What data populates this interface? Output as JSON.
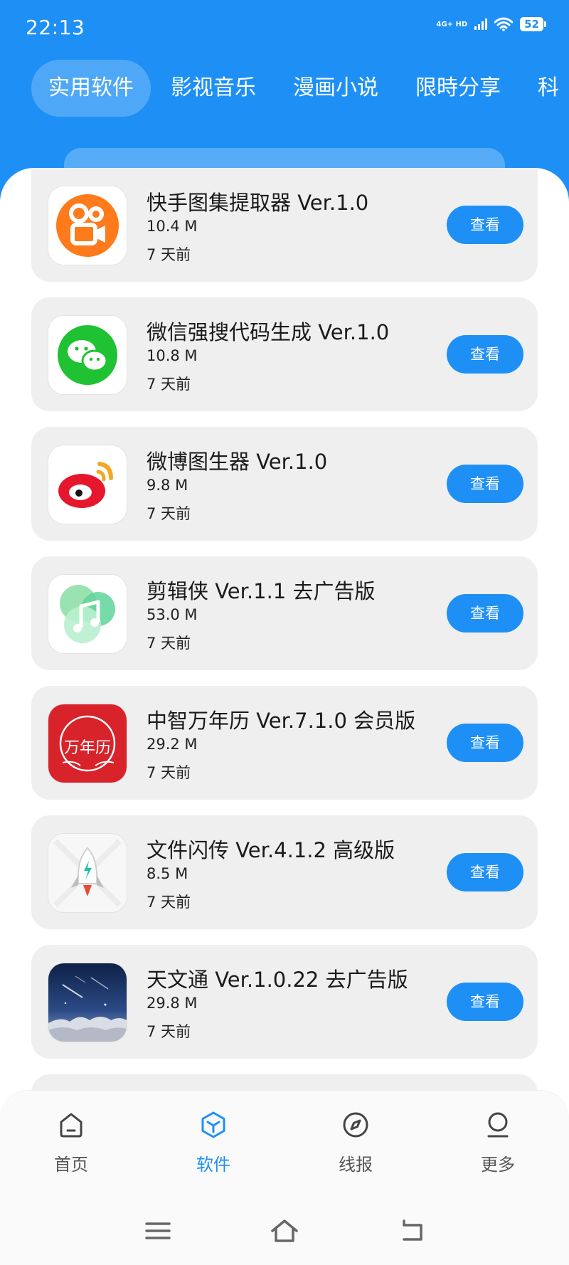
{
  "status_bar": {
    "time": "22:13",
    "network_label": "4G+ HD",
    "battery": "52"
  },
  "tabs": [
    {
      "label": "实用软件",
      "active": true
    },
    {
      "label": "影视音乐",
      "active": false
    },
    {
      "label": "漫画小说",
      "active": false
    },
    {
      "label": "限時分享",
      "active": false
    },
    {
      "label": "科",
      "active": false
    }
  ],
  "apps": [
    {
      "name": "快手图集提取器 Ver.1.0",
      "size": "10.4 M",
      "time": "7 天前",
      "button": "查看",
      "icon": "kuaishou-icon"
    },
    {
      "name": "微信强搜代码生成 Ver.1.0",
      "size": "10.8 M",
      "time": "7 天前",
      "button": "查看",
      "icon": "wechat-icon"
    },
    {
      "name": "微博图生器 Ver.1.0",
      "size": "9.8 M",
      "time": "7 天前",
      "button": "查看",
      "icon": "weibo-icon"
    },
    {
      "name": "剪辑侠 Ver.1.1 去广告版",
      "size": "53.0 M",
      "time": "7 天前",
      "button": "查看",
      "icon": "music-note-icon"
    },
    {
      "name": "中智万年历 Ver.7.1.0 会员版",
      "size": "29.2 M",
      "time": "7 天前",
      "button": "查看",
      "icon": "calendar-icon"
    },
    {
      "name": "文件闪传 Ver.4.1.2 高级版",
      "size": "8.5 M",
      "time": "7 天前",
      "button": "查看",
      "icon": "rocket-icon"
    },
    {
      "name": "天文通 Ver.1.0.22 去广告版",
      "size": "29.8 M",
      "time": "7 天前",
      "button": "查看",
      "icon": "night-sky-icon"
    }
  ],
  "calendar_icon_text": "万年历",
  "bottom_nav": [
    {
      "label": "首页",
      "icon": "home-icon",
      "active": false
    },
    {
      "label": "软件",
      "icon": "cube-icon",
      "active": true
    },
    {
      "label": "线报",
      "icon": "compass-icon",
      "active": false
    },
    {
      "label": "更多",
      "icon": "profile-icon",
      "active": false
    }
  ],
  "colors": {
    "accent": "#1e90f5",
    "card_bg": "#efefef",
    "nav_active": "#1e90f5"
  }
}
